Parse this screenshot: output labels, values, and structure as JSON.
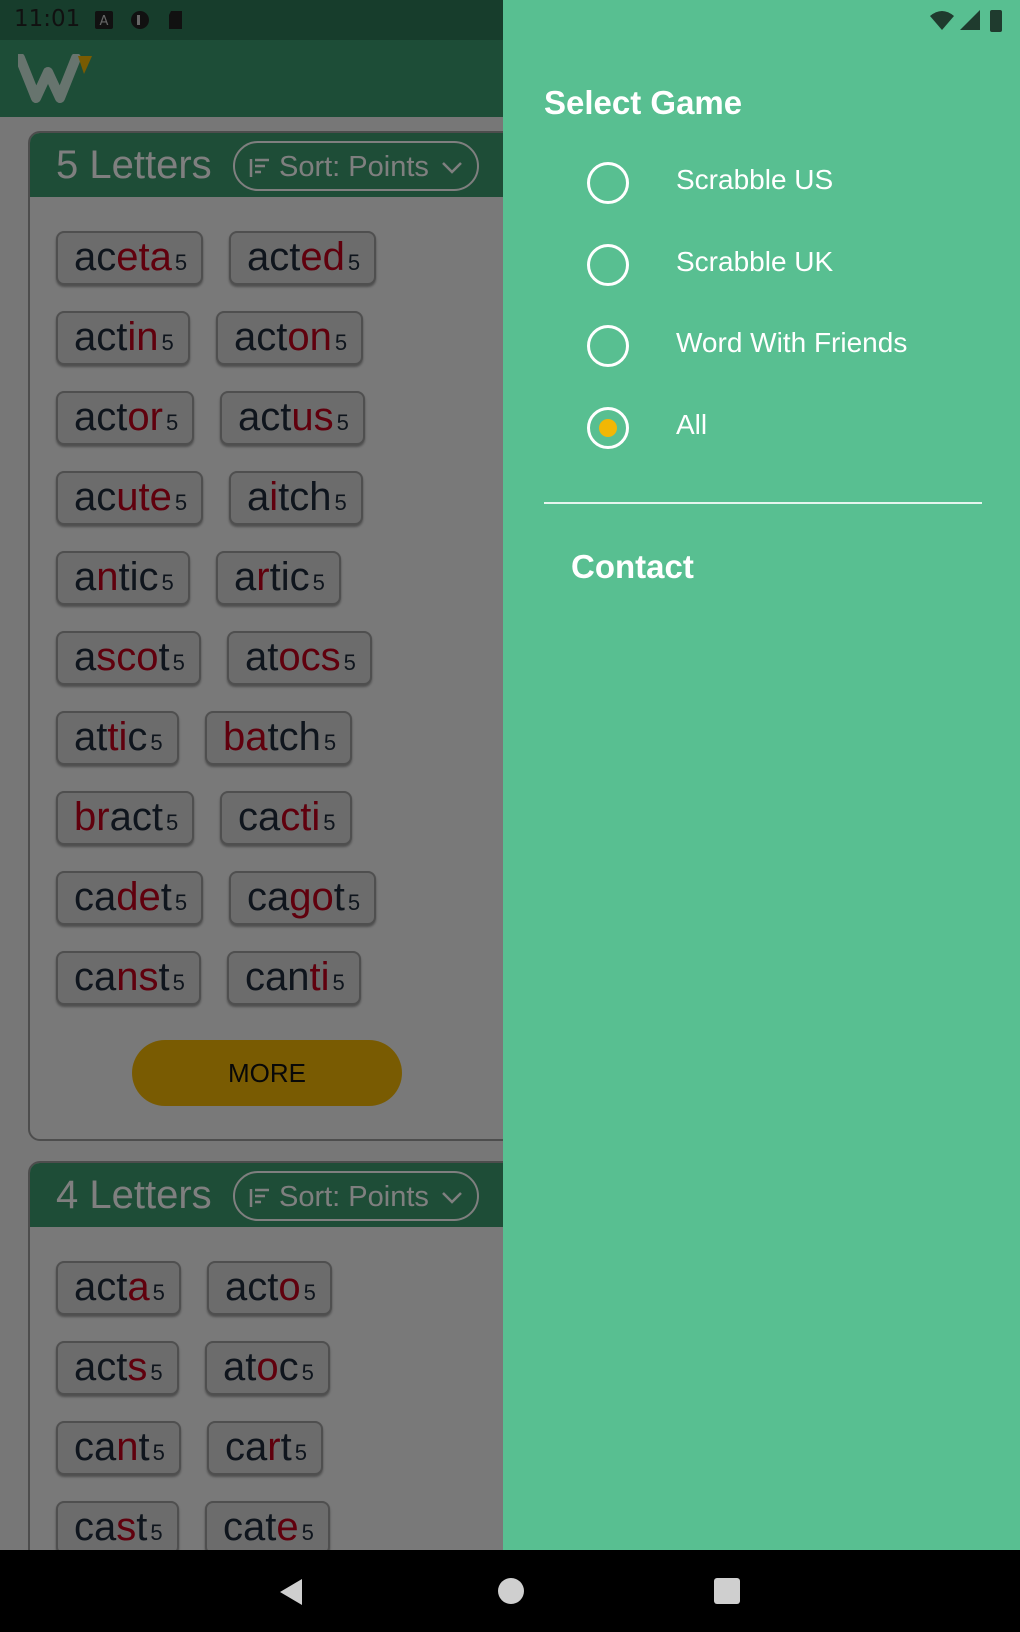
{
  "status_bar": {
    "time": "11:01"
  },
  "sections": [
    {
      "title": "5 Letters",
      "sort_label": "Sort: Points",
      "more_label": "MORE",
      "words": [
        [
          {
            "parts": [
              [
                "ac",
                0
              ],
              [
                "eta",
                1
              ]
            ],
            "pts": "5"
          },
          {
            "parts": [
              [
                "act",
                0
              ],
              [
                "ed",
                1
              ]
            ],
            "pts": "5"
          }
        ],
        [
          {
            "parts": [
              [
                "act",
                0
              ],
              [
                "in",
                1
              ]
            ],
            "pts": "5"
          },
          {
            "parts": [
              [
                "act",
                0
              ],
              [
                "on",
                1
              ]
            ],
            "pts": "5"
          }
        ],
        [
          {
            "parts": [
              [
                "act",
                0
              ],
              [
                "or",
                1
              ]
            ],
            "pts": "5"
          },
          {
            "parts": [
              [
                "act",
                0
              ],
              [
                "us",
                1
              ]
            ],
            "pts": "5"
          }
        ],
        [
          {
            "parts": [
              [
                "ac",
                0
              ],
              [
                "ute",
                1
              ]
            ],
            "pts": "5"
          },
          {
            "parts": [
              [
                "a",
                0
              ],
              [
                "i",
                1
              ],
              [
                "tch",
                0
              ]
            ],
            "pts": "5"
          }
        ],
        [
          {
            "parts": [
              [
                "a",
                0
              ],
              [
                "n",
                1
              ],
              [
                "tic",
                0
              ]
            ],
            "pts": "5"
          },
          {
            "parts": [
              [
                "a",
                0
              ],
              [
                "r",
                1
              ],
              [
                "tic",
                0
              ]
            ],
            "pts": "5"
          }
        ],
        [
          {
            "parts": [
              [
                "a",
                0
              ],
              [
                "sco",
                1
              ],
              [
                "t",
                0
              ]
            ],
            "pts": "5"
          },
          {
            "parts": [
              [
                "at",
                0
              ],
              [
                "ocs",
                1
              ]
            ],
            "pts": "5"
          }
        ],
        [
          {
            "parts": [
              [
                "at",
                0
              ],
              [
                "ti",
                1
              ],
              [
                "c",
                0
              ]
            ],
            "pts": "5"
          },
          {
            "parts": [
              [
                "ba",
                1
              ],
              [
                "tch",
                0
              ]
            ],
            "pts": "5"
          }
        ],
        [
          {
            "parts": [
              [
                "br",
                1
              ],
              [
                "act",
                0
              ]
            ],
            "pts": "5"
          },
          {
            "parts": [
              [
                "ca",
                0
              ],
              [
                "cti",
                1
              ]
            ],
            "pts": "5"
          }
        ],
        [
          {
            "parts": [
              [
                "ca",
                0
              ],
              [
                "de",
                1
              ],
              [
                "t",
                0
              ]
            ],
            "pts": "5"
          },
          {
            "parts": [
              [
                "ca",
                0
              ],
              [
                "go",
                1
              ],
              [
                "t",
                0
              ]
            ],
            "pts": "5"
          }
        ],
        [
          {
            "parts": [
              [
                "ca",
                0
              ],
              [
                "ns",
                1
              ],
              [
                "t",
                0
              ]
            ],
            "pts": "5"
          },
          {
            "parts": [
              [
                "can",
                0
              ],
              [
                "ti",
                1
              ]
            ],
            "pts": "5"
          }
        ]
      ]
    },
    {
      "title": "4 Letters",
      "sort_label": "Sort: Points",
      "words": [
        [
          {
            "parts": [
              [
                "act",
                0
              ],
              [
                "a",
                1
              ]
            ],
            "pts": "5"
          },
          {
            "parts": [
              [
                "act",
                0
              ],
              [
                "o",
                1
              ]
            ],
            "pts": "5"
          }
        ],
        [
          {
            "parts": [
              [
                "act",
                0
              ],
              [
                "s",
                1
              ]
            ],
            "pts": "5"
          },
          {
            "parts": [
              [
                "at",
                0
              ],
              [
                "o",
                1
              ],
              [
                "c",
                0
              ]
            ],
            "pts": "5"
          }
        ],
        [
          {
            "parts": [
              [
                "ca",
                0
              ],
              [
                "n",
                1
              ],
              [
                "t",
                0
              ]
            ],
            "pts": "5"
          },
          {
            "parts": [
              [
                "ca",
                0
              ],
              [
                "r",
                1
              ],
              [
                "t",
                0
              ]
            ],
            "pts": "5"
          }
        ],
        [
          {
            "parts": [
              [
                "ca",
                0
              ],
              [
                "s",
                1
              ],
              [
                "t",
                0
              ]
            ],
            "pts": "5"
          },
          {
            "parts": [
              [
                "cat",
                0
              ],
              [
                "e",
                1
              ]
            ],
            "pts": "5"
          }
        ]
      ]
    }
  ],
  "drawer": {
    "select_game_title": "Select Game",
    "options": [
      {
        "label": "Scrabble US",
        "selected": false
      },
      {
        "label": "Scrabble UK",
        "selected": false
      },
      {
        "label": "Word With Friends",
        "selected": false
      },
      {
        "label": "All",
        "selected": true
      }
    ],
    "contact_label": "Contact"
  },
  "colors": {
    "header_green": "#3d9a6e",
    "drawer_green": "#58bf91",
    "accent_yellow": "#f2b705",
    "highlight_red": "#c0001a"
  }
}
